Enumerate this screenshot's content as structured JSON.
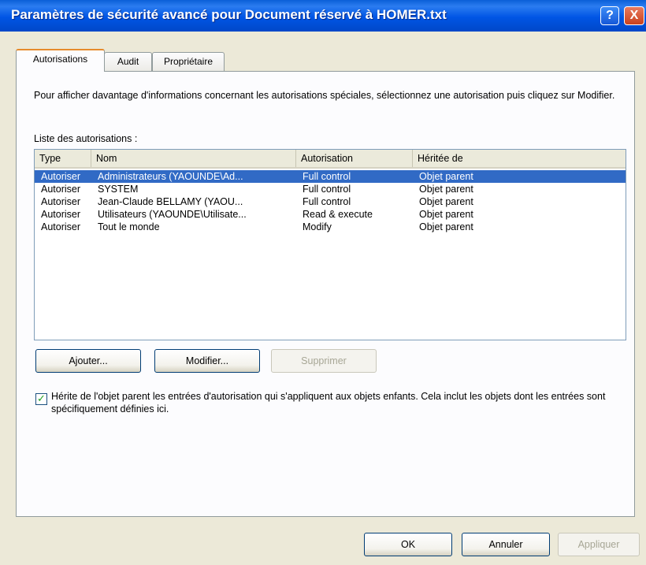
{
  "window": {
    "title": "Paramètres de sécurité avancé pour Document réservé à HOMER.txt",
    "help_glyph": "?",
    "close_glyph": "X"
  },
  "tabs": [
    {
      "label": "Autorisations",
      "active": true
    },
    {
      "label": "Audit",
      "active": false
    },
    {
      "label": "Propriétaire",
      "active": false
    }
  ],
  "description": "Pour afficher davantage d'informations concernant les autorisations spéciales, sélectionnez une autorisation puis cliquez sur Modifier.",
  "list_label": "Liste des autorisations :",
  "columns": [
    "Type",
    "Nom",
    "Autorisation",
    "Héritée de"
  ],
  "rows": [
    {
      "type": "Autoriser",
      "nom": "Administrateurs (YAOUNDE\\Ad...",
      "autorisation": "Full control",
      "heritee": "Objet parent",
      "selected": true
    },
    {
      "type": "Autoriser",
      "nom": "SYSTEM",
      "autorisation": "Full control",
      "heritee": "Objet parent",
      "selected": false
    },
    {
      "type": "Autoriser",
      "nom": "Jean-Claude BELLAMY (YAOU...",
      "autorisation": "Full control",
      "heritee": "Objet parent",
      "selected": false
    },
    {
      "type": "Autoriser",
      "nom": "Utilisateurs (YAOUNDE\\Utilisate...",
      "autorisation": "Read & execute",
      "heritee": "Objet parent",
      "selected": false
    },
    {
      "type": "Autoriser",
      "nom": "Tout le monde",
      "autorisation": "Modify",
      "heritee": "Objet parent",
      "selected": false
    }
  ],
  "buttons": {
    "ajouter": "Ajouter...",
    "modifier": "Modifier...",
    "supprimer": "Supprimer",
    "ok": "OK",
    "annuler": "Annuler",
    "appliquer": "Appliquer"
  },
  "inherit_checkbox": {
    "checked": true,
    "label": "Hérite de l'objet parent les entrées d'autorisation qui s'appliquent aux objets enfants. Cela inclut les objets dont les entrées sont spécifiquement définies ici."
  },
  "colors": {
    "selection": "#316ac5",
    "titlebar": "#0055e5",
    "tab_accent": "#e68b2c"
  }
}
